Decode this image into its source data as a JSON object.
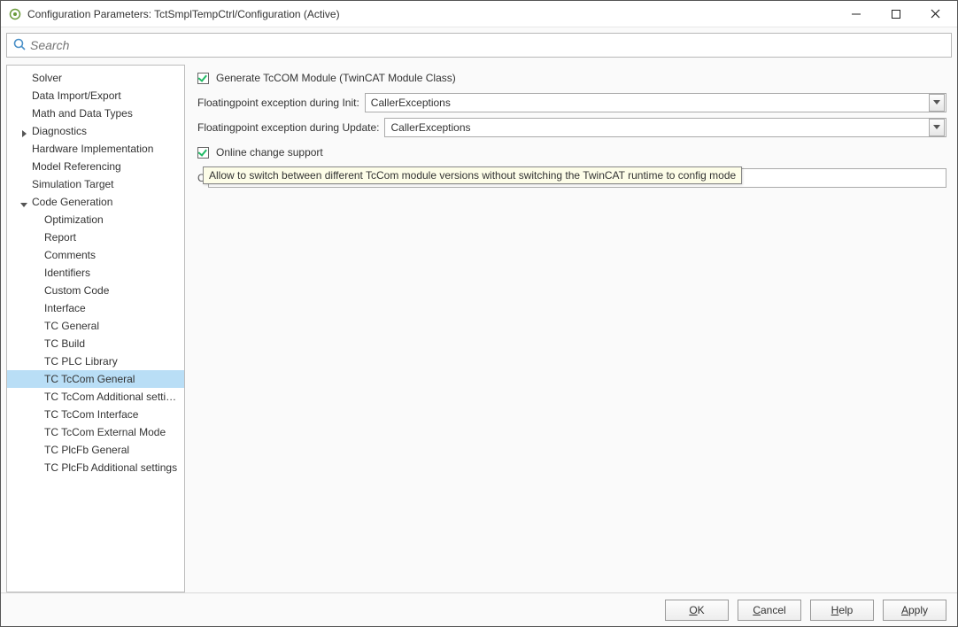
{
  "window": {
    "title": "Configuration Parameters: TctSmplTempCtrl/Configuration (Active)"
  },
  "search": {
    "placeholder": "Search"
  },
  "sidebar": {
    "items": [
      {
        "label": "Solver",
        "level": 1
      },
      {
        "label": "Data Import/Export",
        "level": 1
      },
      {
        "label": "Math and Data Types",
        "level": 1
      },
      {
        "label": "Diagnostics",
        "level": 1,
        "expandable": true,
        "expanded": false
      },
      {
        "label": "Hardware Implementation",
        "level": 1
      },
      {
        "label": "Model Referencing",
        "level": 1
      },
      {
        "label": "Simulation Target",
        "level": 1
      },
      {
        "label": "Code Generation",
        "level": 1,
        "expandable": true,
        "expanded": true
      },
      {
        "label": "Optimization",
        "level": 2
      },
      {
        "label": "Report",
        "level": 2
      },
      {
        "label": "Comments",
        "level": 2
      },
      {
        "label": "Identifiers",
        "level": 2
      },
      {
        "label": "Custom Code",
        "level": 2
      },
      {
        "label": "Interface",
        "level": 2
      },
      {
        "label": "TC General",
        "level": 2
      },
      {
        "label": "TC Build",
        "level": 2
      },
      {
        "label": "TC PLC Library",
        "level": 2
      },
      {
        "label": "TC TcCom General",
        "level": 2,
        "selected": true
      },
      {
        "label": "TC TcCom Additional setti…",
        "level": 2
      },
      {
        "label": "TC TcCom Interface",
        "level": 2
      },
      {
        "label": "TC TcCom External Mode",
        "level": 2
      },
      {
        "label": "TC PlcFb General",
        "level": 2
      },
      {
        "label": "TC PlcFb Additional settings",
        "level": 2
      }
    ]
  },
  "form": {
    "generate_label": "Generate TcCOM Module (TwinCAT Module Class)",
    "generate_checked": true,
    "fp_init_label": "Floatingpoint exception during Init:",
    "fp_init_value": "CallerExceptions",
    "fp_update_label": "Floatingpoint exception during Update:",
    "fp_update_value": "CallerExceptions",
    "online_change_label": "Online change support",
    "online_change_checked": true,
    "tooltip_text": "Allow to switch between different TcCom module versions without switching the TwinCAT runtime to config mode"
  },
  "buttons": {
    "ok": "OK",
    "cancel": "Cancel",
    "help": "Help",
    "apply": "Apply"
  }
}
